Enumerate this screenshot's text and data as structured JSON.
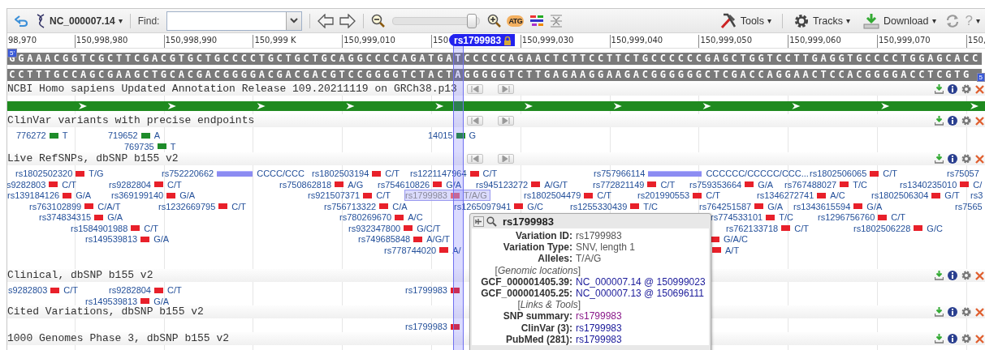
{
  "toolbar": {
    "sequence": "NC_000007.14",
    "caret": "▾",
    "find_label": "Find:",
    "zoom": {
      "level": 0.9
    },
    "atg": "ATG",
    "menus": [
      {
        "label": "Tools",
        "kind": "tools",
        "caret": "▾"
      },
      {
        "label": "Tracks",
        "kind": "tracks",
        "caret": "▾"
      },
      {
        "label": "Download",
        "kind": "download",
        "caret": "▾"
      }
    ],
    "help": "?",
    "help_caret": "▾"
  },
  "ruler": {
    "ticks": [
      "98,970",
      "150,998,980",
      "150,998,990",
      "150,999 K",
      "150,999,010",
      "150",
      "150,999,030",
      "150,999,040",
      "150,999,050",
      "150,999,060",
      "150,999,070",
      "150,"
    ],
    "marker": "rs1799983"
  },
  "sequence": {
    "forward": "GGAAACGGTCGCTTCGACGTGCTGCCCCTGCTGCTGCAGGCCCCAGATGATCCCCCAGAACTCTTCCTTCTGCCCCCCGAGCTGGTCCTTGAGGTGCCCCTGGAGCACC",
    "reverse": "CCTTTGCCAGCGAAGCTGCACGACGGGGACGACGACGTCCGGGGTCTACTAGGGGGTCTTGAGAAGGAAGACGGGGGGCTCGACCAGGAACTCCACGGGGACCTCGTG",
    "start_mark": "5'",
    "end_mark": "5"
  },
  "tracks": [
    {
      "title": "NCBI Homo sapiens Updated Annotation Release 109.20211119 on GRCh38.p13",
      "kind": "gene"
    },
    {
      "title": "ClinVar variants with precise endpoints",
      "kind": "clinvar",
      "features": [
        {
          "label": "776272",
          "alleles": "T",
          "kind": "snv"
        },
        {
          "label": "719652",
          "alleles": "A",
          "kind": "snv"
        },
        {
          "label": "14015",
          "alleles": "G",
          "kind": "snv"
        },
        {
          "label": "769735",
          "alleles": "T",
          "kind": "snv"
        }
      ]
    },
    {
      "title": "Live RefSNPs, dbSNP b155 v2",
      "kind": "dbsnp",
      "features": [
        {
          "label": "rs1802502320",
          "alleles": "T/G",
          "kind": "snv"
        },
        {
          "label": "rs752220662",
          "alleles": "CCCC/CCC",
          "kind": "indel"
        },
        {
          "label": "rs1802503194",
          "alleles": "C/T",
          "kind": "snv"
        },
        {
          "label": "rs1221147964",
          "alleles": "C/T",
          "kind": "snv"
        },
        {
          "label": "rs757966114",
          "alleles": "CCCCCC/CCCCC/CCC...",
          "kind": "indel"
        },
        {
          "label": "rs1802506065",
          "alleles": "C/T",
          "kind": "snv"
        },
        {
          "label": "rs75057",
          "kind": "edge"
        },
        {
          "label": "s9282803",
          "alleles": "C/T",
          "kind": "snv"
        },
        {
          "label": "rs9282804",
          "alleles": "C/T",
          "kind": "snv"
        },
        {
          "label": "rs750862818",
          "alleles": "A/G",
          "kind": "snv"
        },
        {
          "label": "rs754610826",
          "alleles": "G/A",
          "kind": "snv"
        },
        {
          "label": "rs945123272",
          "alleles": "A/G/T",
          "kind": "snv"
        },
        {
          "label": "rs772821149",
          "alleles": "C/T",
          "kind": "snv"
        },
        {
          "label": "rs759353664",
          "alleles": "G/A",
          "kind": "snv"
        },
        {
          "label": "rs767488027",
          "alleles": "T/C",
          "kind": "snv"
        },
        {
          "label": "rs1340235010",
          "alleles": "C/",
          "kind": "snv"
        },
        {
          "label": "rs139184126",
          "alleles": "G/A",
          "kind": "snv"
        },
        {
          "label": "rs369199140",
          "alleles": "G/A",
          "kind": "snv"
        },
        {
          "label": "rs921507371",
          "alleles": "C/T",
          "kind": "snv"
        },
        {
          "label": "rs1799983",
          "alleles": "T/A/G",
          "kind": "selected"
        },
        {
          "label": "rs1802504479",
          "alleles": "C/T",
          "kind": "snv"
        },
        {
          "label": "rs201990553",
          "alleles": "C/T",
          "kind": "snv"
        },
        {
          "label": "rs1346272741",
          "alleles": "A/C",
          "kind": "snv"
        },
        {
          "label": "rs1802506304",
          "alleles": "G/T",
          "kind": "snv"
        },
        {
          "label": "rs3",
          "kind": "edge"
        },
        {
          "label": "rs763102899",
          "alleles": "C/A/T",
          "kind": "snv"
        },
        {
          "label": "rs1232669795",
          "alleles": "C/T",
          "kind": "snv"
        },
        {
          "label": "rs756713322",
          "alleles": "C/A",
          "kind": "snv"
        },
        {
          "label": "rs1265097941",
          "alleles": "G/C",
          "kind": "snv"
        },
        {
          "label": "rs1255330439",
          "alleles": "T/C",
          "kind": "snv"
        },
        {
          "label": "rs764251587",
          "alleles": "G/A",
          "kind": "snv"
        },
        {
          "label": "rs1343615594",
          "alleles": "G/A",
          "kind": "snv"
        },
        {
          "label": "rs7565",
          "kind": "edge"
        },
        {
          "label": "rs374834315",
          "alleles": "G/A",
          "kind": "snv"
        },
        {
          "label": "rs780269670",
          "alleles": "A/C",
          "kind": "snv"
        },
        {
          "label": "rs774533101",
          "alleles": "T/C",
          "kind": "snv"
        },
        {
          "label": "rs1296756760",
          "alleles": "C/T",
          "kind": "snv"
        },
        {
          "label": "rs1584901988",
          "alleles": "C/T",
          "kind": "snv"
        },
        {
          "label": "rs932347800",
          "alleles": "G/C/T",
          "kind": "snv"
        },
        {
          "label": "rs762133718",
          "alleles": "C/T",
          "kind": "snv"
        },
        {
          "label": "rs1802506228",
          "alleles": "G/C",
          "kind": "snv"
        },
        {
          "label": "rs149539813",
          "alleles": "G/A",
          "kind": "snv"
        },
        {
          "label": "rs749685848",
          "alleles": "A/G/T",
          "kind": "snv"
        },
        {
          "alleles": "G/A/C",
          "kind": "snv"
        },
        {
          "label": "rs778744020",
          "alleles": "A/",
          "kind": "snv"
        },
        {
          "alleles": "A/T",
          "kind": "snv"
        }
      ]
    },
    {
      "title": "Clinical, dbSNP b155 v2",
      "kind": "dbsnp",
      "features": [
        {
          "label": "s9282803",
          "alleles": "C/T",
          "kind": "snv"
        },
        {
          "label": "rs9282804",
          "alleles": "C/T",
          "kind": "snv"
        },
        {
          "label": "rs1799983",
          "kind": "snv"
        },
        {
          "label": "rs149539813",
          "alleles": "G/A",
          "kind": "snv"
        }
      ]
    },
    {
      "title": "Cited Variations, dbSNP b155 v2",
      "kind": "dbsnp",
      "features": [
        {
          "label": "rs1799983",
          "kind": "snv"
        }
      ]
    },
    {
      "title": "1000 Genomes Phase 3, dbSNP b155 v2",
      "kind": "dbsnp"
    }
  ],
  "popup": {
    "title": "rs1799983",
    "items": [
      {
        "label": "Variation ID:",
        "value": "rs1799983",
        "kind": "field"
      },
      {
        "label": "Variation Type:",
        "value": "SNV, length 1",
        "kind": "field"
      },
      {
        "label": "Alleles:",
        "value": "T/A/G",
        "kind": "field"
      },
      {
        "label": "[*Genomic locations*]",
        "kind": "section"
      },
      {
        "label": "GCF_000001405.39:",
        "value": "NC_000007.14 @ 150999023",
        "kind": "link"
      },
      {
        "label": "GCF_000001405.25:",
        "value": "NC_000007.13 @ 150696111",
        "kind": "link"
      },
      {
        "label": "[*Links & Tools*]",
        "kind": "section"
      },
      {
        "label": "SNP summary:",
        "value": "rs1799983",
        "kind": "visited"
      },
      {
        "label": "ClinVar (3):",
        "value": "rs1799983",
        "kind": "link"
      },
      {
        "label": "PubMed (281):",
        "value": "rs1799983",
        "kind": "link"
      }
    ]
  }
}
